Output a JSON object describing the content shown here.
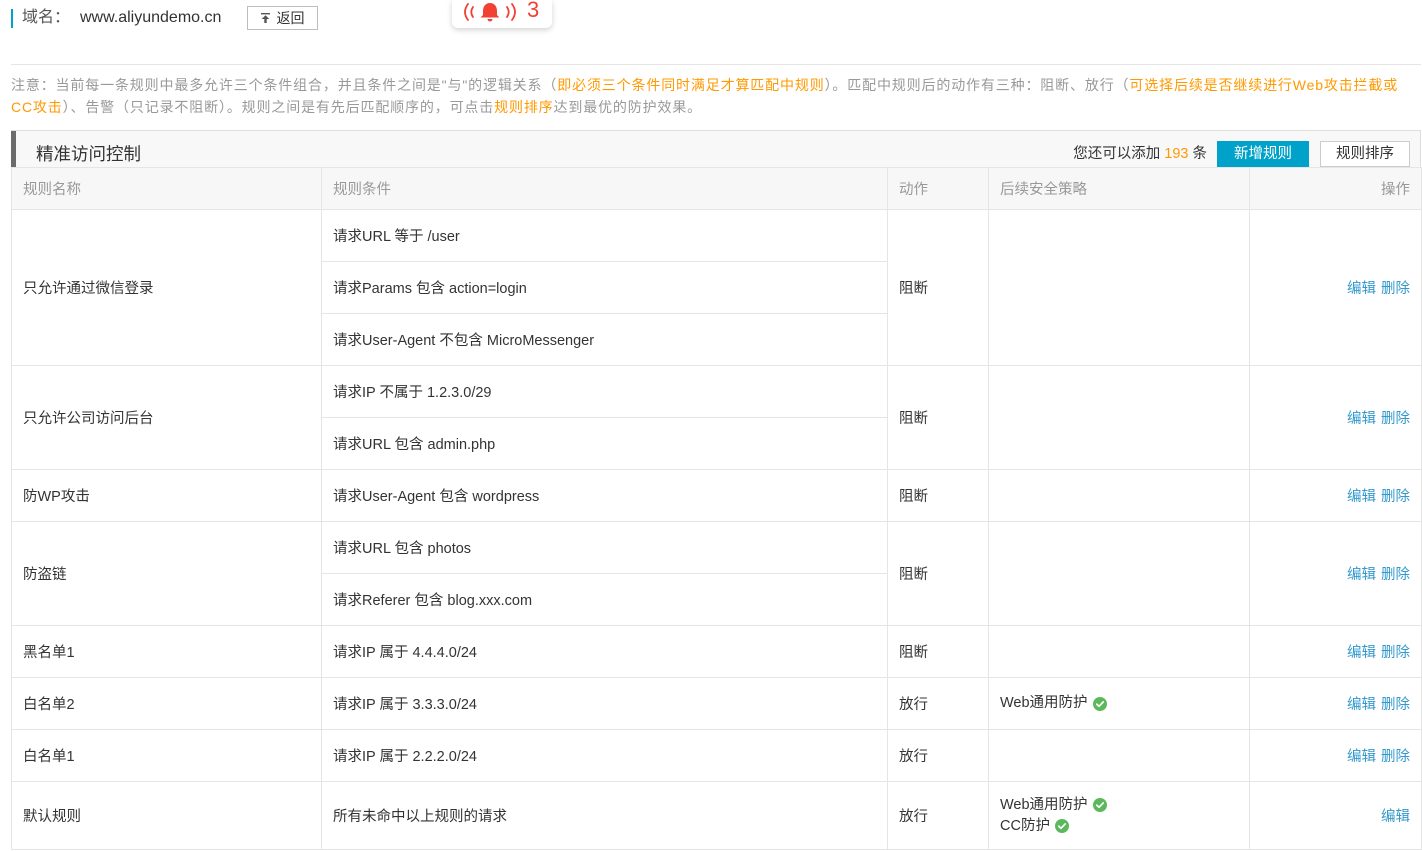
{
  "colors": {
    "accent": "#00a2ca",
    "link": "#3399cc",
    "highlight": "#ff9900",
    "success": "#5cb85c",
    "alert": "#f04134"
  },
  "header": {
    "domain_label": "域名：",
    "domain_value": "www.aliyundemo.cn",
    "back_button": {
      "label": "返回",
      "icon": "upload-icon"
    }
  },
  "notification": {
    "icon": "bell-alarm-icon",
    "count": "3"
  },
  "notice": {
    "segments": [
      {
        "text": "注意：当前每一条规则中最多允许三个条件组合，并且条件之间是\"与\"的逻辑关系（",
        "highlight": false
      },
      {
        "text": "即必须三个条件同时满足才算匹配中规则",
        "highlight": true
      },
      {
        "text": "）。匹配中规则后的动作有三种：阻断、放行（",
        "highlight": false
      },
      {
        "text": "可选择后续是否继续进行Web攻击拦截或CC攻击",
        "highlight": true
      },
      {
        "text": "）、告警（只记录不阻断）。规则之间是有先后匹配顺序的，可点击",
        "highlight": false
      },
      {
        "text": "规则排序",
        "highlight": true
      },
      {
        "text": "达到最优的防护效果。",
        "highlight": false
      }
    ]
  },
  "panel": {
    "title": "精准访问控制",
    "quota": {
      "prefix": "您还可以添加",
      "count": "193",
      "suffix": "条"
    },
    "add_button": "新增规则",
    "sort_button": "规则排序"
  },
  "table": {
    "columns": [
      "规则名称",
      "规则条件",
      "动作",
      "后续安全策略",
      "操作"
    ],
    "rows": [
      {
        "name": "只允许通过微信登录",
        "conditions": [
          "请求URL 等于 /user",
          "请求Params 包含 action=login",
          "请求User-Agent 不包含 MicroMessenger"
        ],
        "action": "阻断",
        "policies": [],
        "operations": [
          "编辑",
          "删除"
        ]
      },
      {
        "name": "只允许公司访问后台",
        "conditions": [
          "请求IP 不属于 1.2.3.0/29",
          "请求URL 包含 admin.php"
        ],
        "action": "阻断",
        "policies": [],
        "operations": [
          "编辑",
          "删除"
        ]
      },
      {
        "name": "防WP攻击",
        "conditions": [
          "请求User-Agent 包含 wordpress"
        ],
        "action": "阻断",
        "policies": [],
        "operations": [
          "编辑",
          "删除"
        ]
      },
      {
        "name": "防盗链",
        "conditions": [
          "请求URL 包含 photos",
          "请求Referer 包含 blog.xxx.com"
        ],
        "action": "阻断",
        "policies": [],
        "operations": [
          "编辑",
          "删除"
        ]
      },
      {
        "name": "黑名单1",
        "conditions": [
          "请求IP 属于 4.4.4.0/24"
        ],
        "action": "阻断",
        "policies": [],
        "operations": [
          "编辑",
          "删除"
        ]
      },
      {
        "name": "白名单2",
        "conditions": [
          "请求IP 属于 3.3.3.0/24"
        ],
        "action": "放行",
        "policies": [
          {
            "label": "Web通用防护",
            "icon": "check-circle-icon"
          }
        ],
        "operations": [
          "编辑",
          "删除"
        ]
      },
      {
        "name": "白名单1",
        "conditions": [
          "请求IP 属于 2.2.2.0/24"
        ],
        "action": "放行",
        "policies": [],
        "operations": [
          "编辑",
          "删除"
        ]
      },
      {
        "name": "默认规则",
        "conditions": [
          "所有未命中以上规则的请求"
        ],
        "action": "放行",
        "policies": [
          {
            "label": "Web通用防护",
            "icon": "check-circle-icon"
          },
          {
            "label": "CC防护",
            "icon": "check-circle-icon"
          }
        ],
        "operations": [
          "编辑"
        ]
      }
    ]
  }
}
